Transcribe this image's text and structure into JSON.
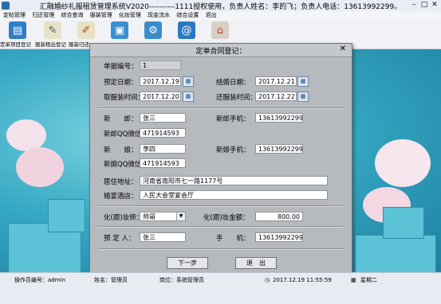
{
  "window": {
    "title": "汇融婚纱礼服租赁管理系统V2020----------1111授权使用，负责人姓名：李的飞；负责人电话：13613992299。"
  },
  "menu": [
    "定帖管理",
    "归还管理",
    "综合查询",
    "服装管理",
    "化妆管理",
    "现金流水",
    "综合设置",
    "退出"
  ],
  "toolbar": [
    {
      "label": "定单项目登记",
      "icon": "document-icon"
    },
    {
      "label": "服装租出登记",
      "icon": "notepad-icon"
    },
    {
      "label": "服装归还",
      "icon": "pencil-icon"
    },
    {
      "label": "",
      "icon": "box-icon"
    },
    {
      "label": "",
      "icon": "gear-icon"
    },
    {
      "label": "",
      "icon": "address-book-icon"
    },
    {
      "label": "",
      "icon": "home-icon"
    }
  ],
  "dialog": {
    "title": "定单合同登记：",
    "close": "✕",
    "fields": {
      "bill_no_label": "单据编号：",
      "bill_no": "1",
      "booking_date_label": "预定日期：",
      "booking_date": "2017.12.19",
      "wedding_date_label": "结婚日期：",
      "wedding_date": "2017.12.21",
      "pickup_time_label": "取服装时间：",
      "pickup_time": "2017.12.20",
      "return_time_label": "还服装时间：",
      "return_time": "2017.12.22",
      "groom_label": "新　　郎：",
      "groom": "张三",
      "groom_phone_label": "新郎手机：",
      "groom_phone": "13613992299",
      "groom_qq_label": "新郎QQ微信：",
      "groom_qq": "471914593",
      "bride_label": "新　　娘：",
      "bride": "李四",
      "bride_phone_label": "新娘手机：",
      "bride_phone": "13613992299",
      "bride_qq_label": "新娘QQ微信：",
      "bride_qq": "471914593",
      "address_label": "居住地址：",
      "address": "河南省南阳市七一路1177号",
      "hotel_label": "婚宴酒店：",
      "hotel": "人民大会堂宴会厅",
      "makeup_artist_label": "化(跟)妆师：",
      "makeup_artist": "帅哥",
      "makeup_fee_label": "化(跟)妆金额：",
      "makeup_fee": "800.00",
      "booker_label": "预 定 人：",
      "booker": "张三",
      "mobile_label": "手　　机：",
      "mobile": "13613992299"
    },
    "buttons": {
      "next": "下一步",
      "exit": "退　出"
    }
  },
  "statusbar": {
    "operator": "操作员编号：admin",
    "name": "姓名：管理员",
    "position": "岗位：系统管理员",
    "datetime": "2017.12.19 11:55:59",
    "weekday": "星期二"
  }
}
